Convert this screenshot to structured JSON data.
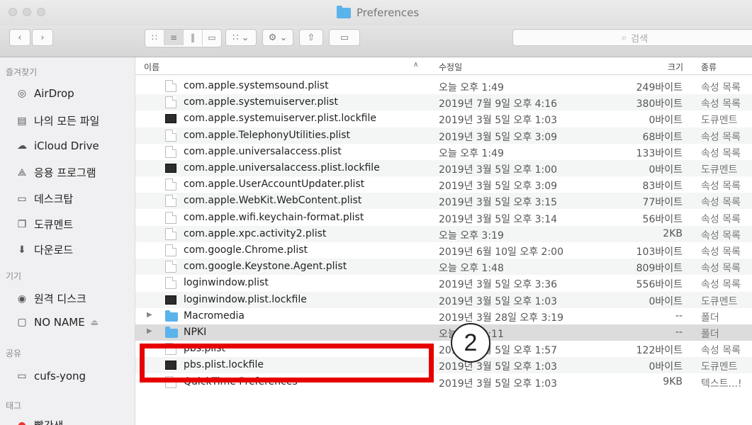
{
  "window": {
    "title": "Preferences"
  },
  "toolbar": {
    "search_placeholder": "검색",
    "search_icon": "search-icon"
  },
  "sidebar": {
    "sections": [
      {
        "header": "즐겨찾기",
        "items": [
          {
            "label": "AirDrop",
            "icon": "airdrop-icon"
          },
          {
            "label": "나의 모든 파일",
            "icon": "all-files-icon"
          },
          {
            "label": "iCloud Drive",
            "icon": "cloud-icon"
          },
          {
            "label": "응용 프로그램",
            "icon": "applications-icon"
          },
          {
            "label": "데스크탑",
            "icon": "desktop-icon"
          },
          {
            "label": "도큐멘트",
            "icon": "documents-icon"
          },
          {
            "label": "다운로드",
            "icon": "downloads-icon"
          }
        ]
      },
      {
        "header": "기기",
        "items": [
          {
            "label": "원격 디스크",
            "icon": "disc-icon"
          },
          {
            "label": "NO NAME",
            "icon": "drive-icon"
          }
        ]
      },
      {
        "header": "공유",
        "items": [
          {
            "label": "cufs-yong",
            "icon": "computer-icon"
          }
        ]
      },
      {
        "header": "태그",
        "items": [
          {
            "label": "빨간색",
            "icon": "red-tag-icon"
          }
        ]
      }
    ]
  },
  "columns": {
    "name": "이름",
    "date": "수정일",
    "size": "크기",
    "kind": "종류"
  },
  "files": [
    {
      "icon": "doc",
      "name": "com.apple.systemsound.plist",
      "date": "오늘 오후 1:49",
      "size": "249바이트",
      "kind": "속성 목록"
    },
    {
      "icon": "doc",
      "name": "com.apple.systemuiserver.plist",
      "date": "2019년 7월 9일 오후 4:16",
      "size": "380바이트",
      "kind": "속성 목록"
    },
    {
      "icon": "lock",
      "name": "com.apple.systemuiserver.plist.lockfile",
      "date": "2019년 3월 5일 오후 1:03",
      "size": "0바이트",
      "kind": "도큐멘트"
    },
    {
      "icon": "doc",
      "name": "com.apple.TelephonyUtilities.plist",
      "date": "2019년 3월 5일 오후 3:09",
      "size": "68바이트",
      "kind": "속성 목록"
    },
    {
      "icon": "doc",
      "name": "com.apple.universalaccess.plist",
      "date": "오늘 오후 1:49",
      "size": "133바이트",
      "kind": "속성 목록"
    },
    {
      "icon": "lock",
      "name": "com.apple.universalaccess.plist.lockfile",
      "date": "2019년 3월 5일 오후 1:00",
      "size": "0바이트",
      "kind": "도큐멘트"
    },
    {
      "icon": "doc",
      "name": "com.apple.UserAccountUpdater.plist",
      "date": "2019년 3월 5일 오후 3:09",
      "size": "83바이트",
      "kind": "속성 목록"
    },
    {
      "icon": "doc",
      "name": "com.apple.WebKit.WebContent.plist",
      "date": "2019년 3월 5일 오후 3:15",
      "size": "77바이트",
      "kind": "속성 목록"
    },
    {
      "icon": "doc",
      "name": "com.apple.wifi.keychain-format.plist",
      "date": "2019년 3월 5일 오후 3:14",
      "size": "56바이트",
      "kind": "속성 목록"
    },
    {
      "icon": "doc",
      "name": "com.apple.xpc.activity2.plist",
      "date": "오늘 오후 3:19",
      "size": "2KB",
      "kind": "속성 목록"
    },
    {
      "icon": "doc",
      "name": "com.google.Chrome.plist",
      "date": "2019년 6월 10일 오후 2:00",
      "size": "103바이트",
      "kind": "속성 목록"
    },
    {
      "icon": "doc",
      "name": "com.google.Keystone.Agent.plist",
      "date": "오늘 오후 1:48",
      "size": "809바이트",
      "kind": "속성 목록"
    },
    {
      "icon": "doc",
      "name": "loginwindow.plist",
      "date": "2019년 3월 5일 오후 3:36",
      "size": "556바이트",
      "kind": "속성 목록"
    },
    {
      "icon": "lock",
      "name": "loginwindow.plist.lockfile",
      "date": "2019년 3월 5일 오후 1:03",
      "size": "0바이트",
      "kind": "도큐멘트"
    },
    {
      "icon": "folder",
      "name": "Macromedia",
      "date": "2019년 3월 28일 오후 3:19",
      "size": "--",
      "kind": "폴더"
    },
    {
      "icon": "folder",
      "name": "NPKI",
      "date": "오늘 오후 3:11",
      "size": "--",
      "kind": "폴더"
    },
    {
      "icon": "doc",
      "name": "pbs.plist",
      "date": "2019년 3월 5일 오후 1:57",
      "size": "122바이트",
      "kind": "속성 목록"
    },
    {
      "icon": "lock",
      "name": "pbs.plist.lockfile",
      "date": "2019년 3월 5일 오후 1:03",
      "size": "0바이트",
      "kind": "도큐멘트"
    },
    {
      "icon": "doc",
      "name": "QuickTime Preferences",
      "date": "2019년 3월 5일 오후 1:03",
      "size": "9KB",
      "kind": "텍스트...!"
    }
  ],
  "annotation": {
    "step_number": "2",
    "color": "#e60000"
  }
}
